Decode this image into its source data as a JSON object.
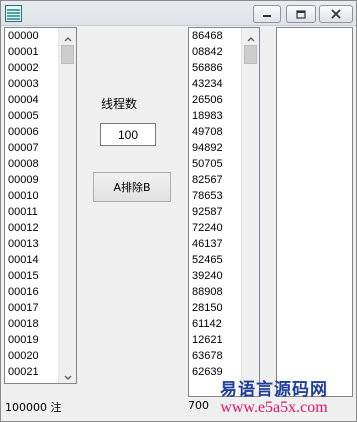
{
  "window": {
    "title": "",
    "controls": [
      "minimize",
      "maximize",
      "close"
    ]
  },
  "left_list": {
    "items": [
      "00000",
      "00001",
      "00002",
      "00003",
      "00004",
      "00005",
      "00006",
      "00007",
      "00008",
      "00009",
      "00010",
      "00011",
      "00012",
      "00013",
      "00014",
      "00015",
      "00016",
      "00017",
      "00018",
      "00019",
      "00020",
      "00021"
    ]
  },
  "middle_list": {
    "items": [
      "86468",
      "08842",
      "56886",
      "43234",
      "26506",
      "18983",
      "49708",
      "94892",
      "50705",
      "82567",
      "78653",
      "92587",
      "72240",
      "46137",
      "52465",
      "39240",
      "88908",
      "28150",
      "61142",
      "12621",
      "63678",
      "62639"
    ]
  },
  "right_list": {
    "items": []
  },
  "controls": {
    "thread_label": "线程数",
    "thread_value": "100",
    "sort_button": "A排除B"
  },
  "status": {
    "left": "100000 注",
    "mid": "700"
  },
  "watermark": {
    "line1": "易语言源码网",
    "line2": "www.e5a5x.com"
  },
  "colors": {
    "watermark_blue": "#1f3f9a",
    "watermark_pink": "#e0156b"
  }
}
